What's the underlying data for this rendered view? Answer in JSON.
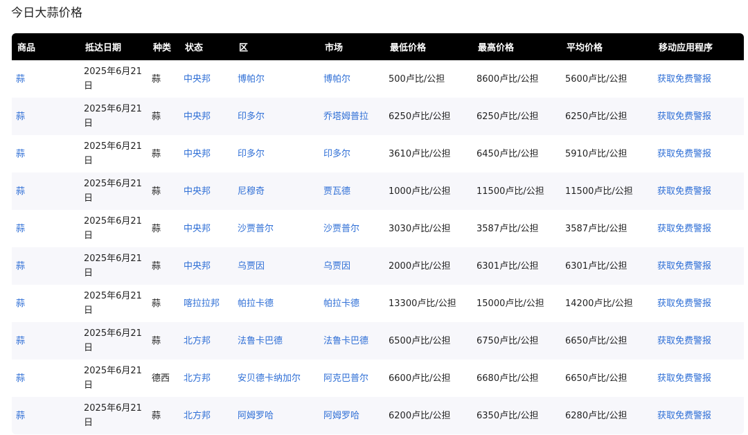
{
  "page_title": "今日大蒜价格",
  "table": {
    "headers": [
      "商品",
      "抵达日期",
      "种类",
      "状态",
      "区",
      "市场",
      "最低价格",
      "最高价格",
      "平均价格",
      "移动应用程序"
    ],
    "rows": [
      {
        "commodity": "蒜",
        "date": "2025年6月21日",
        "variety": "蒜",
        "state": "中央邦",
        "district": "博帕尔",
        "market": "博帕尔",
        "min": "500卢比/公担",
        "max": "8600卢比/公担",
        "avg": "5600卢比/公担",
        "app": "获取免费警报"
      },
      {
        "commodity": "蒜",
        "date": "2025年6月21日",
        "variety": "蒜",
        "state": "中央邦",
        "district": "印多尔",
        "market": "乔塔姆普拉",
        "min": "6250卢比/公担",
        "max": "6250卢比/公担",
        "avg": "6250卢比/公担",
        "app": "获取免费警报"
      },
      {
        "commodity": "蒜",
        "date": "2025年6月21日",
        "variety": "蒜",
        "state": "中央邦",
        "district": "印多尔",
        "market": "印多尔",
        "min": "3610卢比/公担",
        "max": "6450卢比/公担",
        "avg": "5910卢比/公担",
        "app": "获取免费警报"
      },
      {
        "commodity": "蒜",
        "date": "2025年6月21日",
        "variety": "蒜",
        "state": "中央邦",
        "district": "尼穆奇",
        "market": "贾瓦德",
        "min": "1000卢比/公担",
        "max": "11500卢比/公担",
        "avg": "11500卢比/公担",
        "app": "获取免费警报"
      },
      {
        "commodity": "蒜",
        "date": "2025年6月21日",
        "variety": "蒜",
        "state": "中央邦",
        "district": "沙贾普尔",
        "market": "沙贾普尔",
        "min": "3030卢比/公担",
        "max": "3587卢比/公担",
        "avg": "3587卢比/公担",
        "app": "获取免费警报"
      },
      {
        "commodity": "蒜",
        "date": "2025年6月21日",
        "variety": "蒜",
        "state": "中央邦",
        "district": "乌贾因",
        "market": "乌贾因",
        "min": "2000卢比/公担",
        "max": "6301卢比/公担",
        "avg": "6301卢比/公担",
        "app": "获取免费警报"
      },
      {
        "commodity": "蒜",
        "date": "2025年6月21日",
        "variety": "蒜",
        "state": "喀拉拉邦",
        "district": "帕拉卡德",
        "market": "帕拉卡德",
        "min": "13300卢比/公担",
        "max": "15000卢比/公担",
        "avg": "14200卢比/公担",
        "app": "获取免费警报"
      },
      {
        "commodity": "蒜",
        "date": "2025年6月21日",
        "variety": "蒜",
        "state": "北方邦",
        "district": "法鲁卡巴德",
        "market": "法鲁卡巴德",
        "min": "6500卢比/公担",
        "max": "6750卢比/公担",
        "avg": "6650卢比/公担",
        "app": "获取免费警报"
      },
      {
        "commodity": "蒜",
        "date": "2025年6月21日",
        "variety": "德西",
        "state": "北方邦",
        "district": "安贝德卡纳加尔",
        "market": "阿克巴普尔",
        "min": "6600卢比/公担",
        "max": "6680卢比/公担",
        "avg": "6650卢比/公担",
        "app": "获取免费警报"
      },
      {
        "commodity": "蒜",
        "date": "2025年6月21日",
        "variety": "蒜",
        "state": "北方邦",
        "district": "阿姆罗哈",
        "market": "阿姆罗哈",
        "min": "6200卢比/公担",
        "max": "6350卢比/公担",
        "avg": "6280卢比/公担",
        "app": "获取免费警报"
      }
    ]
  },
  "colors": {
    "header_bg": "#000000",
    "link": "#2f6fd6",
    "row_alt": "#f7f7fb"
  }
}
